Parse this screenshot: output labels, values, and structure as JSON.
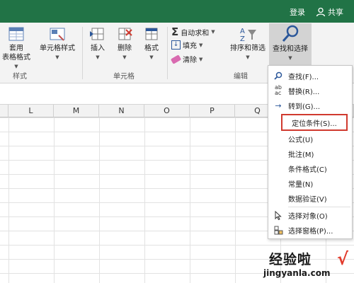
{
  "titlebar": {
    "login": "登录",
    "share": "共享",
    "share_icon": "person-icon"
  },
  "ribbon": {
    "styles_group": {
      "apply_table_line1": "套用",
      "apply_table_line2": "表格格式",
      "cell_styles": "单元格样式",
      "label": "样式"
    },
    "cells_group": {
      "insert": "插入",
      "delete": "删除",
      "format": "格式",
      "label": "单元格"
    },
    "editing_group": {
      "autosum": "自动求和",
      "fill": "填充",
      "clear": "清除",
      "sort_filter": "排序和筛选",
      "find_select": "查找和选择",
      "label": "编辑"
    }
  },
  "columns": [
    "L",
    "M",
    "N",
    "O",
    "P",
    "Q"
  ],
  "find_menu": {
    "items": [
      {
        "label": "查找(F)...",
        "icon": "search-icon"
      },
      {
        "label": "替换(R)...",
        "icon": "replace-icon"
      },
      {
        "label": "转到(G)...",
        "icon": "arrow-right-icon"
      },
      {
        "label": "定位条件(S)...",
        "icon": ""
      },
      {
        "label": "公式(U)",
        "icon": ""
      },
      {
        "label": "批注(M)",
        "icon": ""
      },
      {
        "label": "条件格式(C)",
        "icon": ""
      },
      {
        "label": "常量(N)",
        "icon": ""
      },
      {
        "label": "数据验证(V)",
        "icon": ""
      },
      {
        "label": "选择对象(O)",
        "icon": "cursor-icon"
      },
      {
        "label": "选择窗格(P)...",
        "icon": "selection-pane-icon"
      }
    ],
    "highlighted_index": 3,
    "highlight_color": "#d03a2f"
  },
  "watermark": {
    "line1": "经验啦",
    "check": "√",
    "line2": "jingyanla.com"
  },
  "colors": {
    "accent": "#217346",
    "icon_blue": "#2b579a"
  }
}
